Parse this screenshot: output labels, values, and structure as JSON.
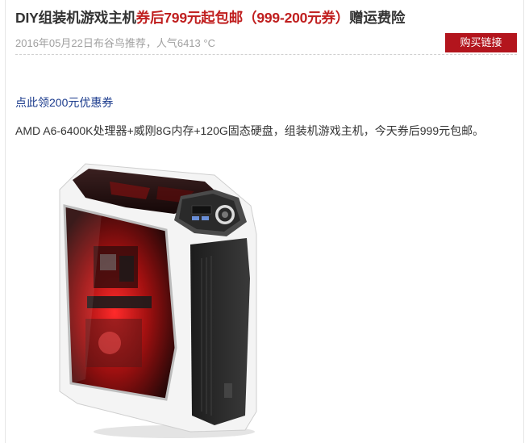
{
  "title": {
    "main": "DIY组装机游戏主机",
    "price": "券后799元起包邮（999-200元券）",
    "extra": "赠运费险"
  },
  "meta": {
    "text": "2016年05月22日布谷鸟推荐，人气6413 °C"
  },
  "buy_button": "购买链接",
  "coupon_link": "点此领200元优惠券",
  "description": "AMD A6-6400K处理器+威刚8G内存+120G固态硬盘，组装机游戏主机，今天券后999元包邮。",
  "colors": {
    "accent_red": "#b3151d",
    "price_red": "#c01f1f",
    "link_blue": "#1a3a8c"
  },
  "product_image": {
    "subject": "white gaming pc case with red led lighting",
    "icon": "pc-case-image"
  }
}
